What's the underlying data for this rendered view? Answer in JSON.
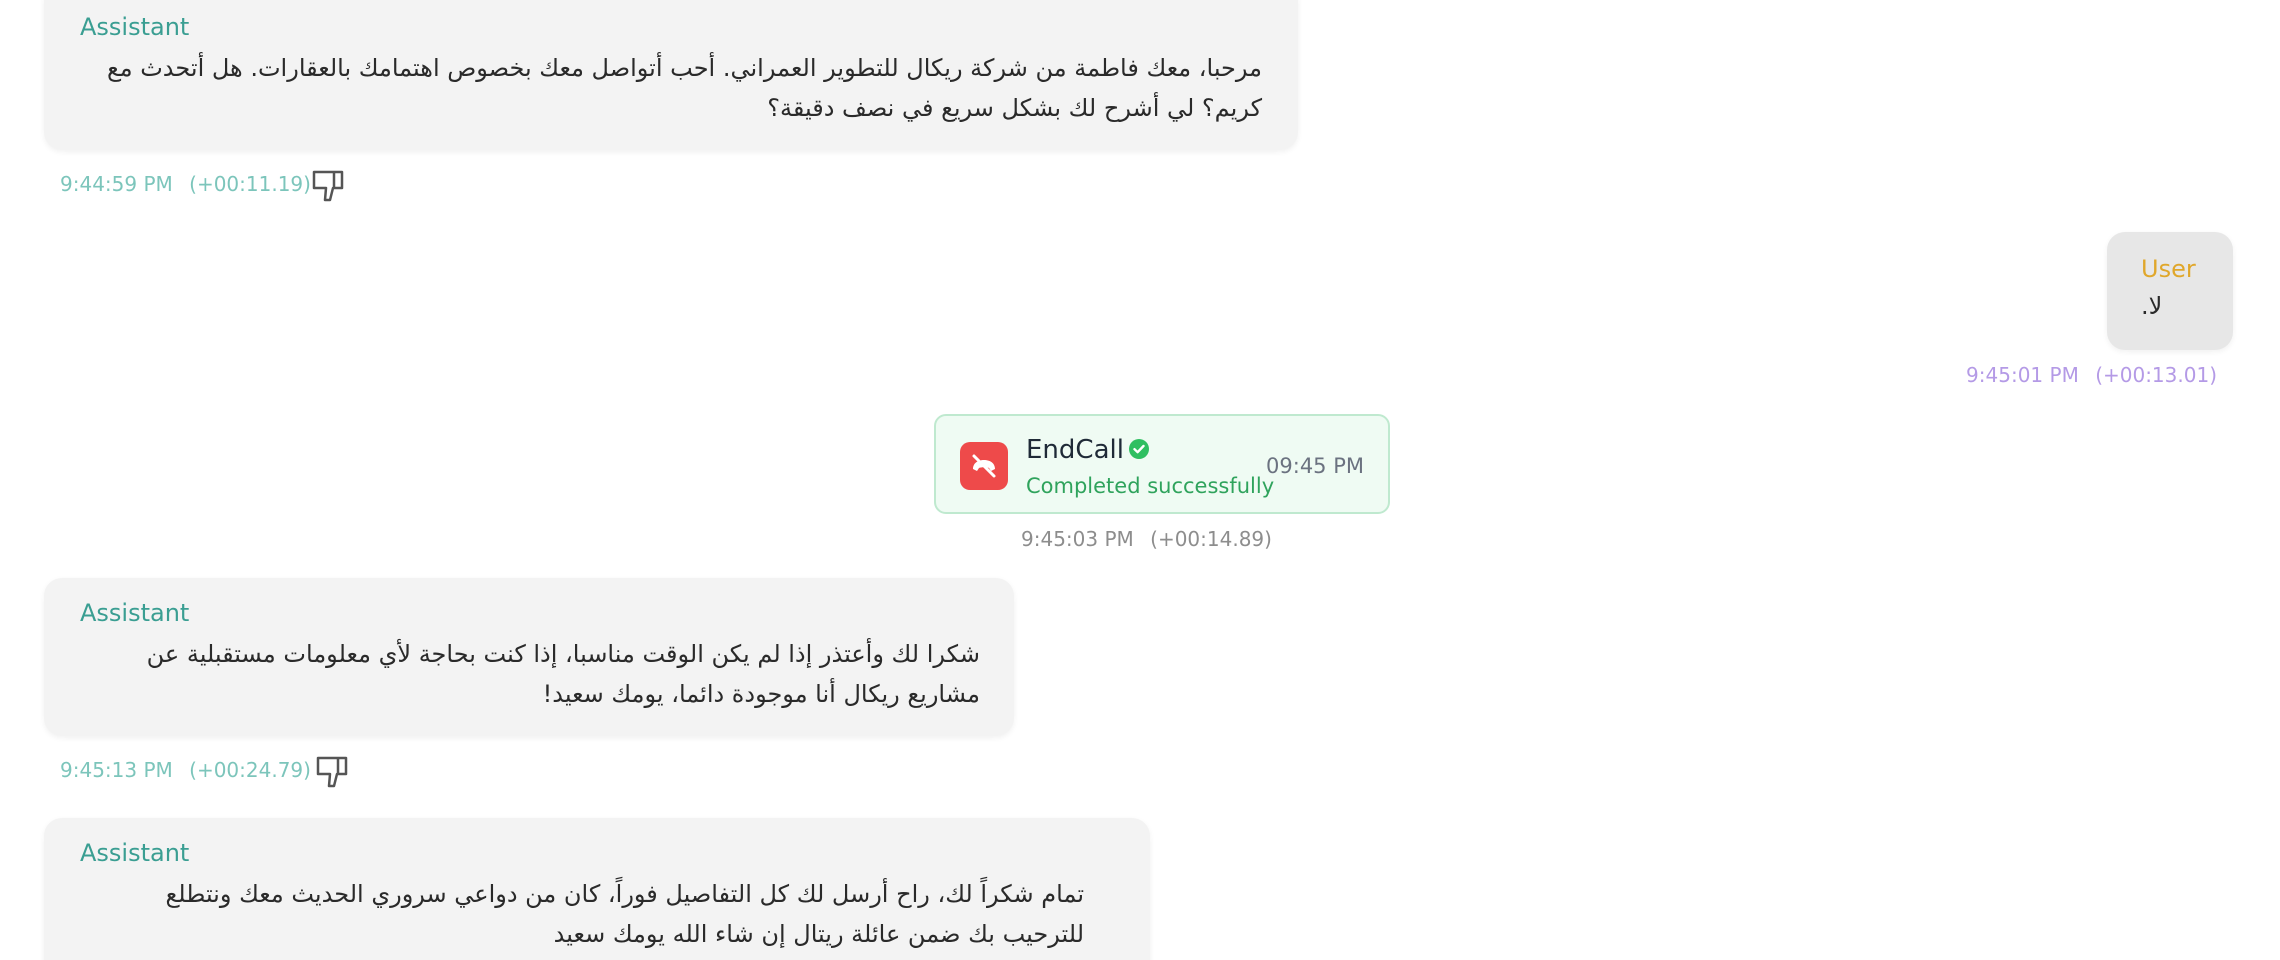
{
  "messages": [
    {
      "role": "Assistant",
      "text": "مرحبا، معك فاطمة من شركة ريكال للتطوير العمراني. أحب أتواصل معك بخصوص اهتمامك بالعقارات. هل أتحدث مع كريم؟ لي أشرح لك بشكل سريع في نصف دقيقة؟",
      "time": "9:44:59 PM",
      "offset": "(+00:11.19)"
    },
    {
      "role": "User",
      "text": "لا.",
      "time": "9:45:01 PM",
      "offset": "(+00:13.01)"
    },
    {
      "role": "Assistant",
      "text": "شكرا لك وأعتذر إذا لم يكن الوقت مناسبا، إذا كنت بحاجة لأي معلومات مستقبلية عن مشاريع ريكال أنا موجودة دائما، يومك سعيد!",
      "time": "9:45:13 PM",
      "offset": "(+00:24.79)"
    },
    {
      "role": "Assistant",
      "text": "تمام شكراً لك، راح أرسل لك كل التفاصيل فوراً، كان من دواعي سروري الحديث معك ونتطلع للترحيب بك ضمن عائلة ريتال إن شاء الله يومك سعيد"
    }
  ],
  "tool_call": {
    "name": "EndCall",
    "status": "Completed successfully",
    "time": "09:45 PM",
    "meta_time": "9:45:03 PM",
    "meta_offset": "(+00:14.89)"
  },
  "icons": {
    "feedback": "thumbs-down-icon",
    "end_call": "phone-off-icon",
    "status": "check-circle-icon"
  },
  "colors": {
    "assistant_role": "#3a9e92",
    "user_role": "#e0a72b",
    "end_call_red": "#ee4a4a",
    "success_green": "#2fa35c"
  }
}
